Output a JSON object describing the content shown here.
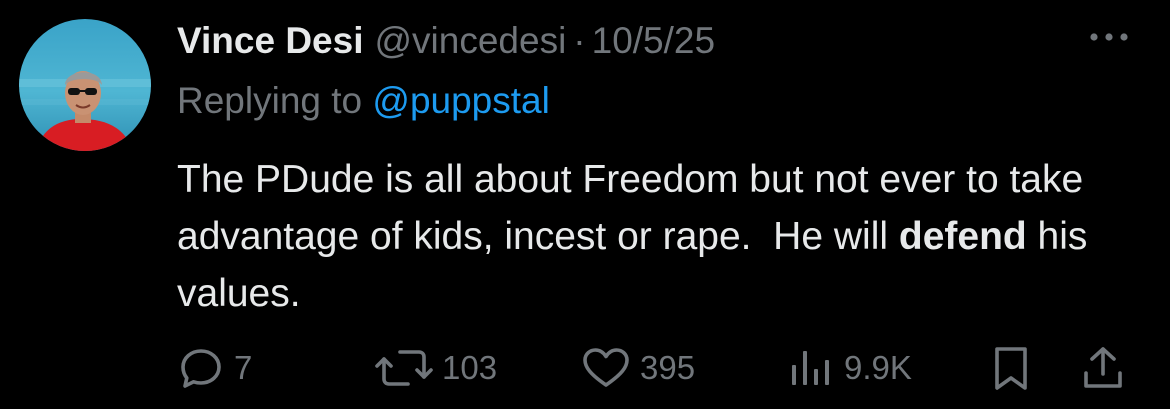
{
  "author": {
    "name": "Vince Desi",
    "handle": "@vincedesi",
    "separator": "·",
    "date": "10/5/25"
  },
  "reply": {
    "prefix": "Replying to",
    "handle": "@puppstal"
  },
  "tweet": {
    "text_before_bold": "The PDude is all about Freedom but not ever to take advantage of kids, incest or rape.  He will ",
    "bold_text": "defend",
    "text_after_bold": " his values."
  },
  "actions": {
    "replies": "7",
    "retweets": "103",
    "likes": "395",
    "views": "9.9K"
  },
  "icons": {
    "more": "more-horizontal-icon",
    "reply": "reply-bubble-icon",
    "retweet": "retweet-icon",
    "like": "heart-icon",
    "views": "views-bar-chart-icon",
    "bookmark": "bookmark-icon",
    "share": "share-icon"
  },
  "colors": {
    "background": "#000000",
    "primary_text": "#e7e9ea",
    "secondary_text": "#71767b",
    "link": "#1d9bf0"
  }
}
